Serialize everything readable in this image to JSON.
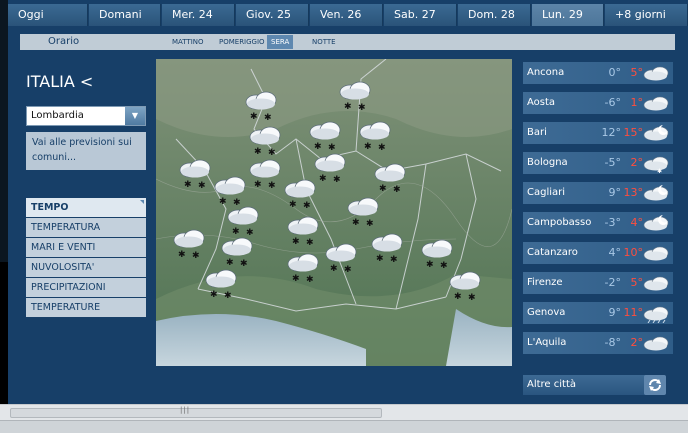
{
  "days": [
    "Oggi",
    "Domani",
    "Mer. 24",
    "Giov. 25",
    "Ven. 26",
    "Sab. 27",
    "Dom. 28",
    "Lun. 29",
    "+8 giorni"
  ],
  "bands": {
    "label": "Orario",
    "items": [
      "MATTINO",
      "POMERIGGIO",
      "SERA",
      "NOTTE"
    ],
    "active": "SERA"
  },
  "region": {
    "title": "ITALIA <",
    "selected": "Lombardia",
    "comuni_link": "Vai alle previsioni sui comuni..."
  },
  "menu": [
    "TEMPO",
    "TEMPERATURA",
    "MARI E VENTI",
    "NUVOLOSITA'",
    "PRECIPITAZIONI",
    "TEMPERATURE"
  ],
  "cities": [
    {
      "name": "Ancona",
      "min": "0°",
      "max": "5°",
      "icon": "cloud-icon"
    },
    {
      "name": "Aosta",
      "min": "-6°",
      "max": "1°",
      "icon": "cloud-icon"
    },
    {
      "name": "Bari",
      "min": "12°",
      "max": "15°",
      "icon": "moon-cloud-icon"
    },
    {
      "name": "Bologna",
      "min": "-5°",
      "max": "2°",
      "icon": "snow-cloud-icon"
    },
    {
      "name": "Cagliari",
      "min": "9°",
      "max": "13°",
      "icon": "moon-cloud-icon"
    },
    {
      "name": "Campobasso",
      "min": "-3°",
      "max": "4°",
      "icon": "moon-cloud-icon"
    },
    {
      "name": "Catanzaro",
      "min": "4°",
      "max": "10°",
      "icon": "cloud-icon"
    },
    {
      "name": "Firenze",
      "min": "-2°",
      "max": "5°",
      "icon": "cloud-icon"
    },
    {
      "name": "Genova",
      "min": "9°",
      "max": "11°",
      "icon": "rain-cloud-icon"
    },
    {
      "name": "L'Aquila",
      "min": "-8°",
      "max": "2°",
      "icon": "cloud-icon"
    }
  ],
  "altre_citta": "Altre città",
  "scroll_grip": "|||",
  "colors": {
    "accent": "#173f68",
    "max_temp": "#ff4e3e",
    "min_temp": "#a9c8e6"
  }
}
